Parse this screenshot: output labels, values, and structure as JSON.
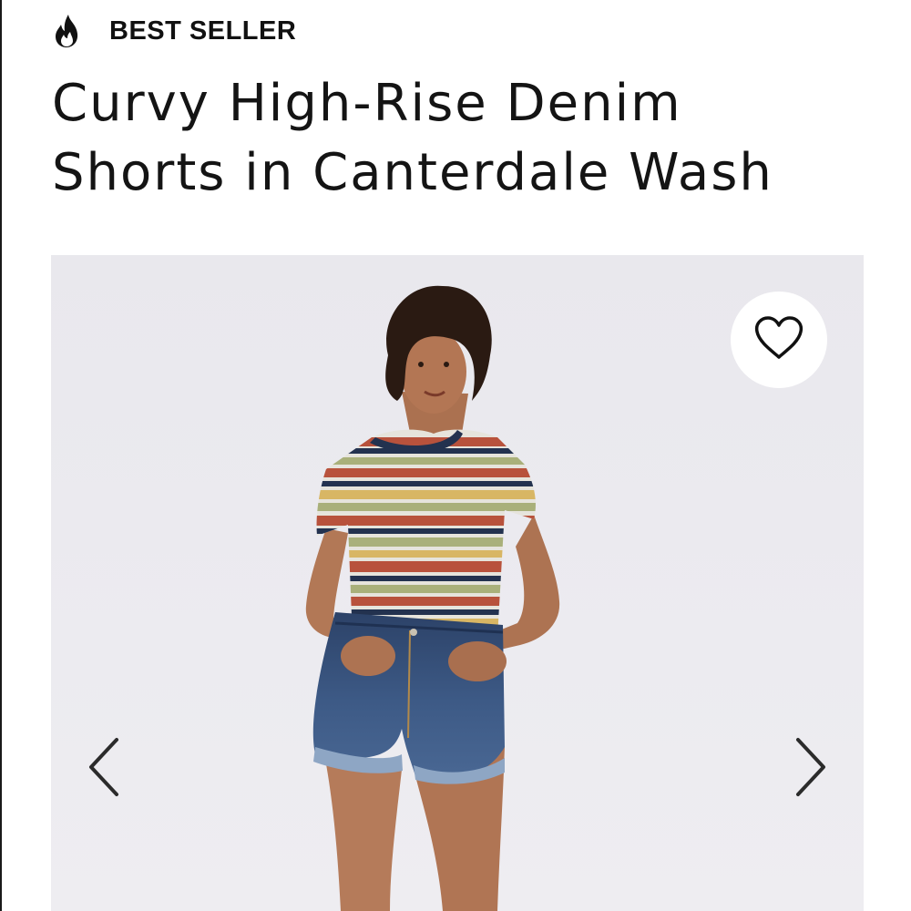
{
  "badge": {
    "icon": "flame-icon",
    "label": "BEST SELLER"
  },
  "product": {
    "title": "Curvy High-Rise Denim Shorts in Canterdale Wash"
  },
  "gallery": {
    "image_description_icon": "product-photo",
    "wishlist_icon": "heart-outline-icon",
    "prev_icon": "chevron-left-icon",
    "next_icon": "chevron-right-icon"
  },
  "colors": {
    "text": "#141414",
    "gallery_bg": "#eae9ee",
    "denim": "#2f4a72",
    "stripe_red": "#b8523c",
    "stripe_navy": "#23324f",
    "stripe_green": "#a9b07a",
    "stripe_yellow": "#d8b664"
  }
}
